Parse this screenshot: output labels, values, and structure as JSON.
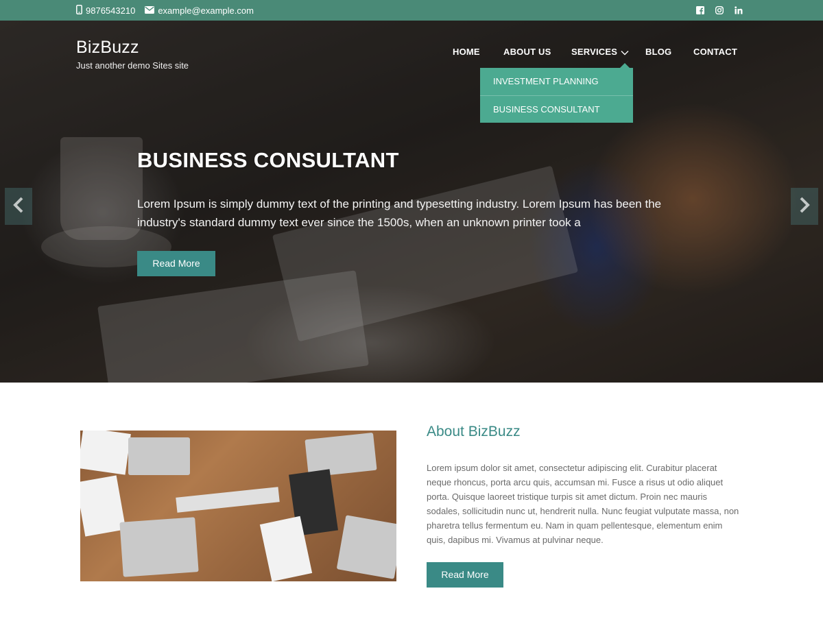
{
  "topbar": {
    "phone": "9876543210",
    "email": "example@example.com",
    "social": [
      "facebook-icon",
      "instagram-icon",
      "linkedin-icon"
    ]
  },
  "brand": {
    "name": "BizBuzz",
    "tagline": "Just another demo Sites site"
  },
  "nav": {
    "items": [
      "HOME",
      "ABOUT US",
      "SERVICES",
      "BLOG",
      "CONTACT"
    ],
    "services_dropdown": [
      "INVESTMENT PLANNING",
      "BUSINESS CONSULTANT"
    ]
  },
  "slider": {
    "title": "BUSINESS CONSULTANT",
    "text": "Lorem Ipsum is simply dummy text of the printing and typesetting industry. Lorem Ipsum has been the industry's standard dummy text ever since the 1500s, when an unknown printer took a",
    "button": "Read More"
  },
  "about": {
    "title": "About BizBuzz",
    "text": "Lorem ipsum dolor sit amet, consectetur adipiscing elit. Curabitur placerat neque rhoncus, porta arcu quis, accumsan mi. Fusce a risus ut odio aliquet porta. Quisque laoreet tristique turpis sit amet dictum. Proin nec mauris sodales, sollicitudin nunc ut, hendrerit nulla. Nunc feugiat vulputate massa, non pharetra tellus fermentum eu. Nam in quam pellentesque, elementum enim quis, dapibus mi. Vivamus at pulvinar neque.",
    "button": "Read More"
  },
  "colors": {
    "topbar": "#4a8a77",
    "dropdown": "#4caa91",
    "button": "#3a8a86",
    "heading_accent": "#3a8a86"
  }
}
